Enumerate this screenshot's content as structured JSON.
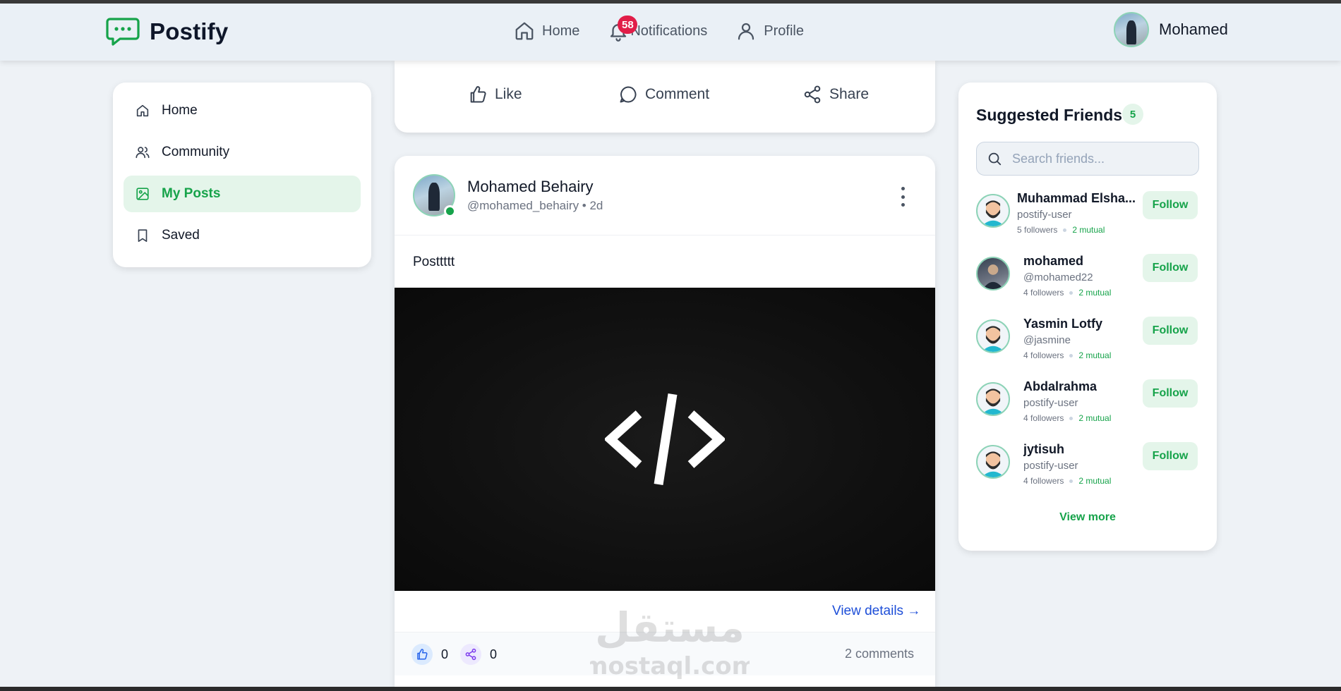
{
  "brand": {
    "name": "Postify",
    "icon": "chat-bubble-icon",
    "accent": "#16a34a"
  },
  "topnav": {
    "items": [
      {
        "label": "Home",
        "icon": "home-icon"
      },
      {
        "label": "Notifications",
        "icon": "bell-icon",
        "badge": "58"
      },
      {
        "label": "Profile",
        "icon": "user-icon"
      }
    ]
  },
  "user": {
    "name": "Mohamed"
  },
  "sidebar": {
    "items": [
      {
        "label": "Home",
        "icon": "home-icon"
      },
      {
        "label": "Community",
        "icon": "users-icon"
      },
      {
        "label": "My Posts",
        "icon": "image-icon",
        "active": true
      },
      {
        "label": "Saved",
        "icon": "bookmark-icon"
      }
    ]
  },
  "prev_post": {
    "actions": {
      "like": "Like",
      "comment": "Comment",
      "share": "Share"
    }
  },
  "post": {
    "author": "Mohamed Behairy",
    "meta": "@mohamed_behairy • 2d",
    "text": "Posttttt",
    "image_glyph": "</>",
    "view_details": "View details →",
    "likes": "0",
    "shares": "0",
    "comments": "2 comments"
  },
  "watermark": {
    "arabic": "مستقل",
    "latin": "mostaql.com"
  },
  "suggested": {
    "title": "Suggested Friends",
    "count": "5",
    "search_placeholder": "Search friends...",
    "follow_label": "Follow",
    "view_more": "View more",
    "friends": [
      {
        "name": "Muhammad Elsha...",
        "handle": "postify-user",
        "followers": "5 followers",
        "mutual": "2 mutual"
      },
      {
        "name": "mohamed",
        "handle": "@mohamed22",
        "followers": "4 followers",
        "mutual": "2 mutual"
      },
      {
        "name": "Yasmin Lotfy",
        "handle": "@jasmine",
        "followers": "4 followers",
        "mutual": "2 mutual"
      },
      {
        "name": "Abdalrahma",
        "handle": "postify-user",
        "followers": "4 followers",
        "mutual": "2 mutual"
      },
      {
        "name": "jytisuh",
        "handle": "postify-user",
        "followers": "4 followers",
        "mutual": "2 mutual"
      }
    ]
  }
}
